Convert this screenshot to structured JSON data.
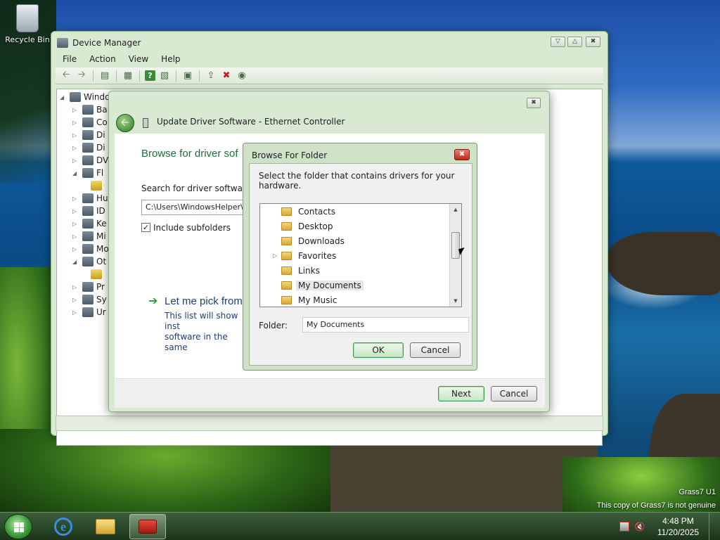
{
  "desktop": {
    "recycle_bin_label": "Recycle Bin",
    "watermark_line1": "Grass7 U1",
    "watermark_line2": "This copy of Grass7 is not genuine"
  },
  "device_manager": {
    "title": "Device Manager",
    "menu": [
      "File",
      "Action",
      "View",
      "Help"
    ],
    "tree": {
      "root": "Windo",
      "items": [
        {
          "label": "Ba",
          "expanded": false
        },
        {
          "label": "Co",
          "expanded": false
        },
        {
          "label": "Di",
          "expanded": false
        },
        {
          "label": "Di",
          "expanded": false
        },
        {
          "label": "DV",
          "expanded": false
        },
        {
          "label": "Fl",
          "expanded": true
        },
        {
          "label": "",
          "expanded": false
        },
        {
          "label": "Hu",
          "expanded": false
        },
        {
          "label": "ID",
          "expanded": false
        },
        {
          "label": "Ke",
          "expanded": false
        },
        {
          "label": "Mi",
          "expanded": false
        },
        {
          "label": "Mo",
          "expanded": false
        },
        {
          "label": "Ot",
          "expanded": true
        },
        {
          "label": "",
          "expanded": false
        },
        {
          "label": "Pr",
          "expanded": false
        },
        {
          "label": "Sy",
          "expanded": false
        },
        {
          "label": "Ur",
          "expanded": false
        }
      ]
    }
  },
  "update_driver": {
    "title": "Update Driver Software - Ethernet Controller",
    "heading": "Browse for driver sof",
    "search_label": "Search for driver software ir",
    "path_value": "C:\\Users\\WindowsHelper\\",
    "include_subfolders_label": "Include subfolders",
    "include_subfolders_checked": true,
    "pick_heading": "Let me pick from",
    "pick_desc_line1": "This list will show inst",
    "pick_desc_line2": "software in the same",
    "next_label": "Next",
    "cancel_label": "Cancel"
  },
  "browse_folder": {
    "title": "Browse For Folder",
    "prompt": "Select the folder that contains drivers for your hardware.",
    "folders": [
      {
        "name": "Contacts",
        "has_children": false,
        "selected": false
      },
      {
        "name": "Desktop",
        "has_children": false,
        "selected": false
      },
      {
        "name": "Downloads",
        "has_children": false,
        "selected": false
      },
      {
        "name": "Favorites",
        "has_children": true,
        "selected": false
      },
      {
        "name": "Links",
        "has_children": false,
        "selected": false
      },
      {
        "name": "My Documents",
        "has_children": false,
        "selected": true
      },
      {
        "name": "My Music",
        "has_children": false,
        "selected": false
      }
    ],
    "folder_label": "Folder:",
    "folder_value": "My Documents",
    "ok_label": "OK",
    "cancel_label": "Cancel"
  },
  "taskbar": {
    "pinned": [
      "internet-explorer",
      "windows-explorer",
      "device-manager"
    ],
    "clock_time": "4:48 PM",
    "clock_date": "11/20/2025"
  },
  "colors": {
    "accent_green": "#1e6d3c",
    "link_blue": "#1e3f7a",
    "taskbar": "#2b4a2a"
  }
}
